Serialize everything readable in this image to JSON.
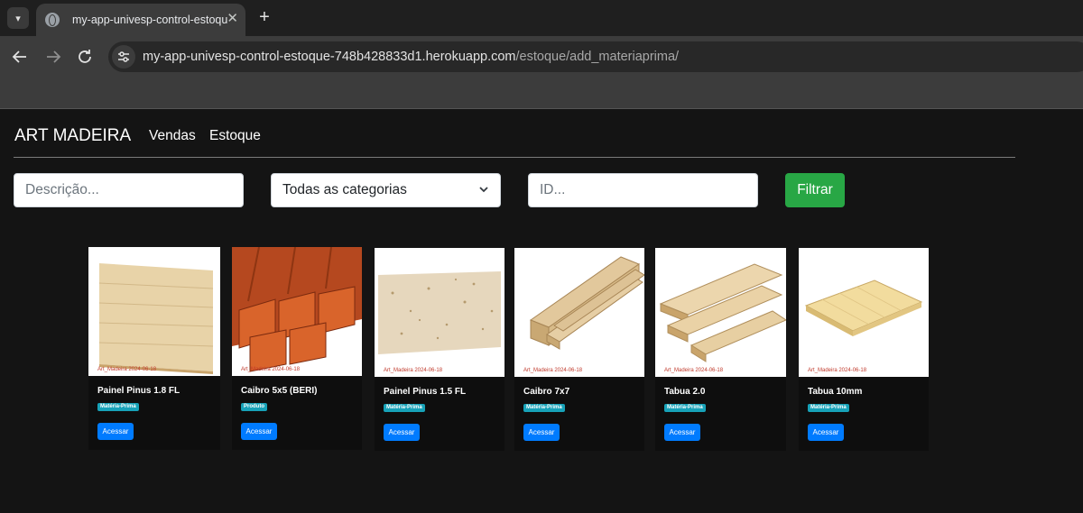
{
  "browser": {
    "tab_title": "my-app-univesp-control-estoque",
    "tab_close": "✕",
    "new_tab": "+",
    "url_host": "my-app-univesp-control-estoque-748b428833d1.herokuapp.com",
    "url_path": "/estoque/add_materiaprima/"
  },
  "navbar": {
    "brand": "ART MADEIRA",
    "links": [
      "Vendas",
      "Estoque"
    ]
  },
  "filters": {
    "description_placeholder": "Descrição...",
    "category_selected": "Todas as categorias",
    "id_placeholder": "ID...",
    "filter_button": "Filtrar"
  },
  "products": [
    {
      "name": "Painel Pinus 1.8 FL",
      "category": "Matéria-Prima",
      "action": "Acessar",
      "watermark": "Art_Madeira 2024-06-18",
      "image": "wood-panel-icon"
    },
    {
      "name": "Caibro 5x5 (BERI)",
      "category": "Produto",
      "action": "Acessar",
      "watermark": "Art_Madeira 2024-06-18",
      "image": "red-beams-icon"
    },
    {
      "name": "Painel Pinus 1.5 FL",
      "category": "Matéria-Prima",
      "action": "Acessar",
      "watermark": "Art_Madeira 2024-06-18",
      "image": "particle-board-icon"
    },
    {
      "name": "Caibro 7x7",
      "category": "Matéria-Prima",
      "action": "Acessar",
      "watermark": "Art_Madeira 2024-06-18",
      "image": "pine-beams-icon"
    },
    {
      "name": "Tabua 2.0",
      "category": "Matéria-Prima",
      "action": "Acessar",
      "watermark": "Art_Madeira 2024-06-18",
      "image": "pine-boards-icon"
    },
    {
      "name": "Tabua 10mm",
      "category": "Matéria-Prima",
      "action": "Acessar",
      "watermark": "Art_Madeira 2024-06-18",
      "image": "thin-board-icon"
    }
  ],
  "colors": {
    "page_bg": "#141414",
    "filter_button": "#28a745",
    "badge": "#17a2b8",
    "access_button": "#007bff"
  }
}
